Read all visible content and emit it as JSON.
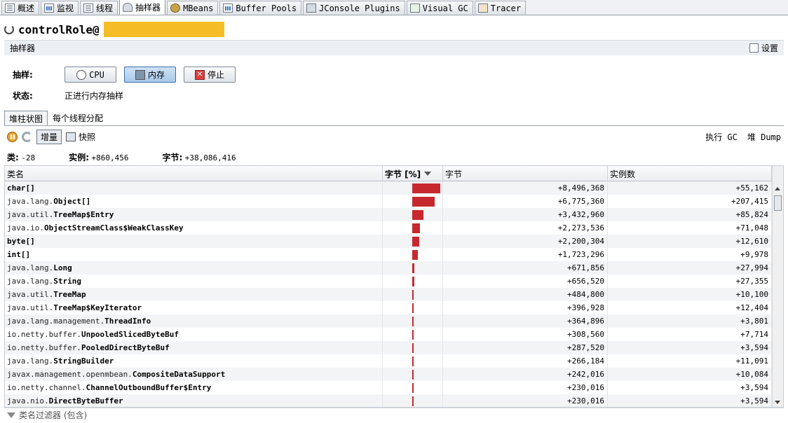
{
  "tabs": [
    {
      "label": "概述",
      "icon": "overview-icon"
    },
    {
      "label": "监视",
      "icon": "monitor-chart-icon"
    },
    {
      "label": "线程",
      "icon": "threads-icon"
    },
    {
      "label": "抽样器",
      "icon": "sampler-icon"
    },
    {
      "label": "MBeans",
      "icon": "mbeans-icon"
    },
    {
      "label": "Buffer Pools",
      "icon": "buffer-pools-icon"
    },
    {
      "label": "JConsole Plugins",
      "icon": "plugin-icon"
    },
    {
      "label": "Visual GC",
      "icon": "visual-gc-icon"
    },
    {
      "label": "Tracer",
      "icon": "tracer-icon"
    }
  ],
  "title": "controlRole@",
  "section": {
    "title": "抽样器",
    "settings_label": "设置"
  },
  "controls": {
    "sample_label": "抽样:",
    "cpu_label": "CPU",
    "memory_label": "内存",
    "stop_label": "停止",
    "status_label": "状态:",
    "status_value": "正进行内存抽样"
  },
  "view_tabs": {
    "histogram": "堆柱状图",
    "per_thread": "每个线程分配"
  },
  "toolbar": {
    "delta_label": "增量",
    "snapshot_label": "快照",
    "gc_label": "执行 GC",
    "heapdump_label": "堆 Dump"
  },
  "summary": {
    "classes_label": "类:",
    "classes_value": "-28",
    "instances_label": "实例:",
    "instances_value": "+860,456",
    "bytes_label": "字节:",
    "bytes_value": "+38,086,416"
  },
  "table": {
    "headers": {
      "name": "类名",
      "bytes_pct": "字节 [%]",
      "bytes": "字节",
      "instances": "实例数"
    },
    "rows": [
      {
        "pkg": "",
        "cls": "char[]",
        "pct": 22.3,
        "bytes": "+8,496,368",
        "instances": "+55,162"
      },
      {
        "pkg": "java.lang.",
        "cls": "Object[]",
        "pct": 17.8,
        "bytes": "+6,775,360",
        "instances": "+207,415"
      },
      {
        "pkg": "java.util.",
        "cls": "TreeMap$Entry",
        "pct": 9.0,
        "bytes": "+3,432,960",
        "instances": "+85,824"
      },
      {
        "pkg": "java.io.",
        "cls": "ObjectStreamClass$WeakClassKey",
        "pct": 6.0,
        "bytes": "+2,273,536",
        "instances": "+71,048"
      },
      {
        "pkg": "",
        "cls": "byte[]",
        "pct": 5.8,
        "bytes": "+2,200,304",
        "instances": "+12,610"
      },
      {
        "pkg": "",
        "cls": "int[]",
        "pct": 4.5,
        "bytes": "+1,723,296",
        "instances": "+9,978"
      },
      {
        "pkg": "java.lang.",
        "cls": "Long",
        "pct": 1.8,
        "bytes": "+671,856",
        "instances": "+27,994"
      },
      {
        "pkg": "java.lang.",
        "cls": "String",
        "pct": 1.7,
        "bytes": "+656,520",
        "instances": "+27,355"
      },
      {
        "pkg": "java.util.",
        "cls": "TreeMap",
        "pct": 1.3,
        "bytes": "+484,800",
        "instances": "+10,100"
      },
      {
        "pkg": "java.util.",
        "cls": "TreeMap$KeyIterator",
        "pct": 1.0,
        "bytes": "+396,928",
        "instances": "+12,404"
      },
      {
        "pkg": "java.lang.management.",
        "cls": "ThreadInfo",
        "pct": 1.0,
        "bytes": "+364,896",
        "instances": "+3,801"
      },
      {
        "pkg": "io.netty.buffer.",
        "cls": "UnpooledSlicedByteBuf",
        "pct": 0.8,
        "bytes": "+308,560",
        "instances": "+7,714"
      },
      {
        "pkg": "io.netty.buffer.",
        "cls": "PooledDirectByteBuf",
        "pct": 0.8,
        "bytes": "+287,520",
        "instances": "+3,594"
      },
      {
        "pkg": "java.lang.",
        "cls": "StringBuilder",
        "pct": 0.7,
        "bytes": "+266,184",
        "instances": "+11,091"
      },
      {
        "pkg": "javax.management.openmbean.",
        "cls": "CompositeDataSupport",
        "pct": 0.6,
        "bytes": "+242,016",
        "instances": "+10,084"
      },
      {
        "pkg": "io.netty.channel.",
        "cls": "ChannelOutboundBuffer$Entry",
        "pct": 0.6,
        "bytes": "+230,016",
        "instances": "+3,594"
      },
      {
        "pkg": "java.nio.",
        "cls": "DirectByteBuffer",
        "pct": 0.6,
        "bytes": "+230,016",
        "instances": "+3,594"
      }
    ]
  },
  "filter": {
    "placeholder": "类名过滤器 (包含)"
  },
  "colors": {
    "bar": "#c7282e",
    "redaction": "#f5bd25"
  }
}
